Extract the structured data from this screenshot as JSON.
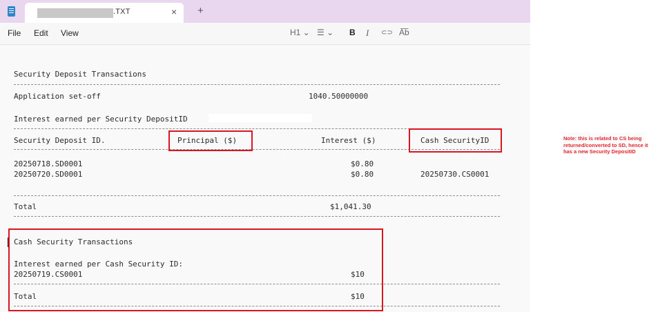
{
  "window": {
    "tab_title": ".TXT",
    "close_glyph": "×",
    "new_tab_glyph": "+"
  },
  "menu": {
    "file": "File",
    "edit": "Edit",
    "view": "View"
  },
  "toolbar": {
    "heading": "H1 ⌄",
    "list": "☰ ⌄",
    "bold": "B",
    "italic": "I",
    "link": "⊂⊃",
    "clear_format": "A͞b"
  },
  "document": {
    "sd_title": "Security Deposit Transactions",
    "app_setoff_label": "Application set-off",
    "app_setoff_value": "1040.50000000",
    "interest_heading": "Interest earned per Security DepositID",
    "headers": {
      "id": "Security Deposit ID.",
      "principal": "Principal ($)",
      "interest": "Interest ($)",
      "cash_id": "Cash SecurityID"
    },
    "rows": [
      {
        "id": "20250718.SD0001",
        "interest": "$0.80",
        "cash_id": ""
      },
      {
        "id": "20250720.SD0001",
        "interest": "$0.80",
        "cash_id": "20250730.CS0001"
      }
    ],
    "total_label": "Total",
    "total_value": "$1,041.30",
    "cs_title": "Cash Security Transactions",
    "cs_interest_heading": "Interest earned per Cash Security ID:",
    "cs_row_id": "20250719.CS0001",
    "cs_row_value": "$10",
    "cs_total_label": "Total",
    "cs_total_value": "$10"
  },
  "annotation": {
    "note": "Note: this is related to CS being returned/converted to SD, hence it has a new Security DepositID"
  }
}
